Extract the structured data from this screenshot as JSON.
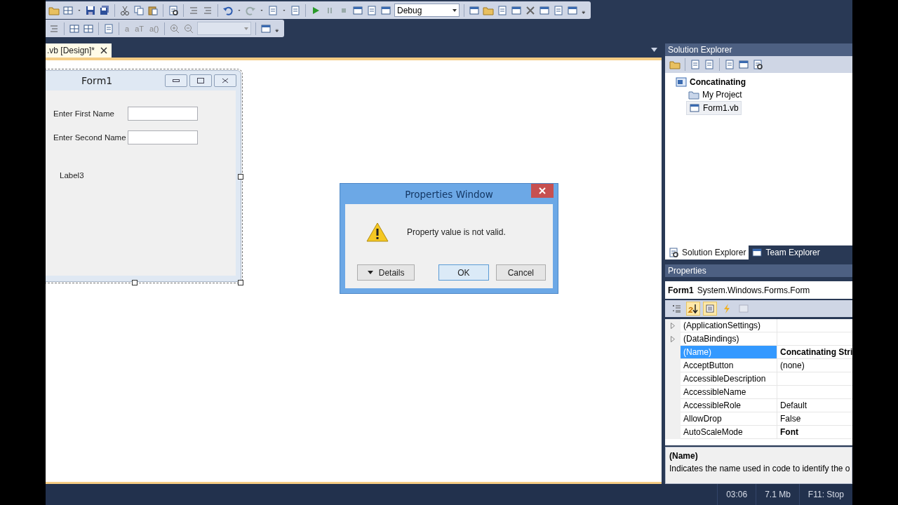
{
  "toolbar": {
    "configuration": "Debug",
    "text_buttons": [
      "a",
      "aT",
      "a()"
    ]
  },
  "document_tabs": [
    {
      "label": ".vb [Design]*",
      "selected": true
    }
  ],
  "designer": {
    "form": {
      "title": "Form1",
      "fields": [
        {
          "label": "Enter First Name"
        },
        {
          "label": "Enter Second Name"
        }
      ],
      "labels": [
        "Label3"
      ],
      "selected": true
    }
  },
  "dialog": {
    "title": "Properties Window",
    "message": "Property value is not valid.",
    "buttons": [
      {
        "label": "Details",
        "kind": "expander"
      },
      {
        "label": "OK",
        "kind": "default"
      },
      {
        "label": "Cancel",
        "kind": "normal"
      }
    ]
  },
  "solution_explorer": {
    "title": "Solution Explorer",
    "tree": [
      {
        "label": "Concatinating",
        "kind": "solution",
        "selected": false,
        "children": [
          {
            "label": "My Project",
            "kind": "folder",
            "selected": false
          },
          {
            "label": "Form1.vb",
            "kind": "form",
            "selected": true
          }
        ]
      }
    ],
    "tabs": [
      {
        "label": "Solution Explorer",
        "selected": true
      },
      {
        "label": "Team Explorer",
        "selected": false
      }
    ]
  },
  "properties": {
    "title": "Properties",
    "object_name": "Form1",
    "object_type": "System.Windows.Forms.Form",
    "view_buttons": [
      {
        "kind": "categorized",
        "selected": false,
        "disabled": false
      },
      {
        "kind": "alphabetical",
        "selected": true,
        "disabled": false
      },
      {
        "kind": "properties",
        "selected": true,
        "disabled": false
      },
      {
        "kind": "events",
        "selected": false,
        "disabled": false
      },
      {
        "kind": "pages",
        "selected": false,
        "disabled": true
      }
    ],
    "rows": [
      {
        "name": "(ApplicationSettings)",
        "expandable": true,
        "selected": false
      },
      {
        "name": "(DataBindings)",
        "expandable": true,
        "selected": false
      },
      {
        "name": "(Name)",
        "value": "Concatinating Stri",
        "expandable": false,
        "selected": true,
        "non_default": true
      },
      {
        "name": "AcceptButton",
        "value": "(none)",
        "expandable": false,
        "selected": false,
        "non_default": false
      },
      {
        "name": "AccessibleDescription",
        "expandable": false,
        "selected": false
      },
      {
        "name": "AccessibleName",
        "expandable": false,
        "selected": false
      },
      {
        "name": "AccessibleRole",
        "value": "Default",
        "expandable": false,
        "selected": false,
        "non_default": false
      },
      {
        "name": "AllowDrop",
        "value": "False",
        "expandable": false,
        "selected": false,
        "non_default": false
      },
      {
        "name": "AutoScaleMode",
        "value": "Font",
        "expandable": false,
        "selected": false,
        "non_default": true
      }
    ],
    "description": {
      "title": "(Name)",
      "text": "Indicates the name used in code to identify the o"
    }
  },
  "status_bar": [
    "03:06",
    "7.1 Mb",
    "F11: Stop"
  ]
}
